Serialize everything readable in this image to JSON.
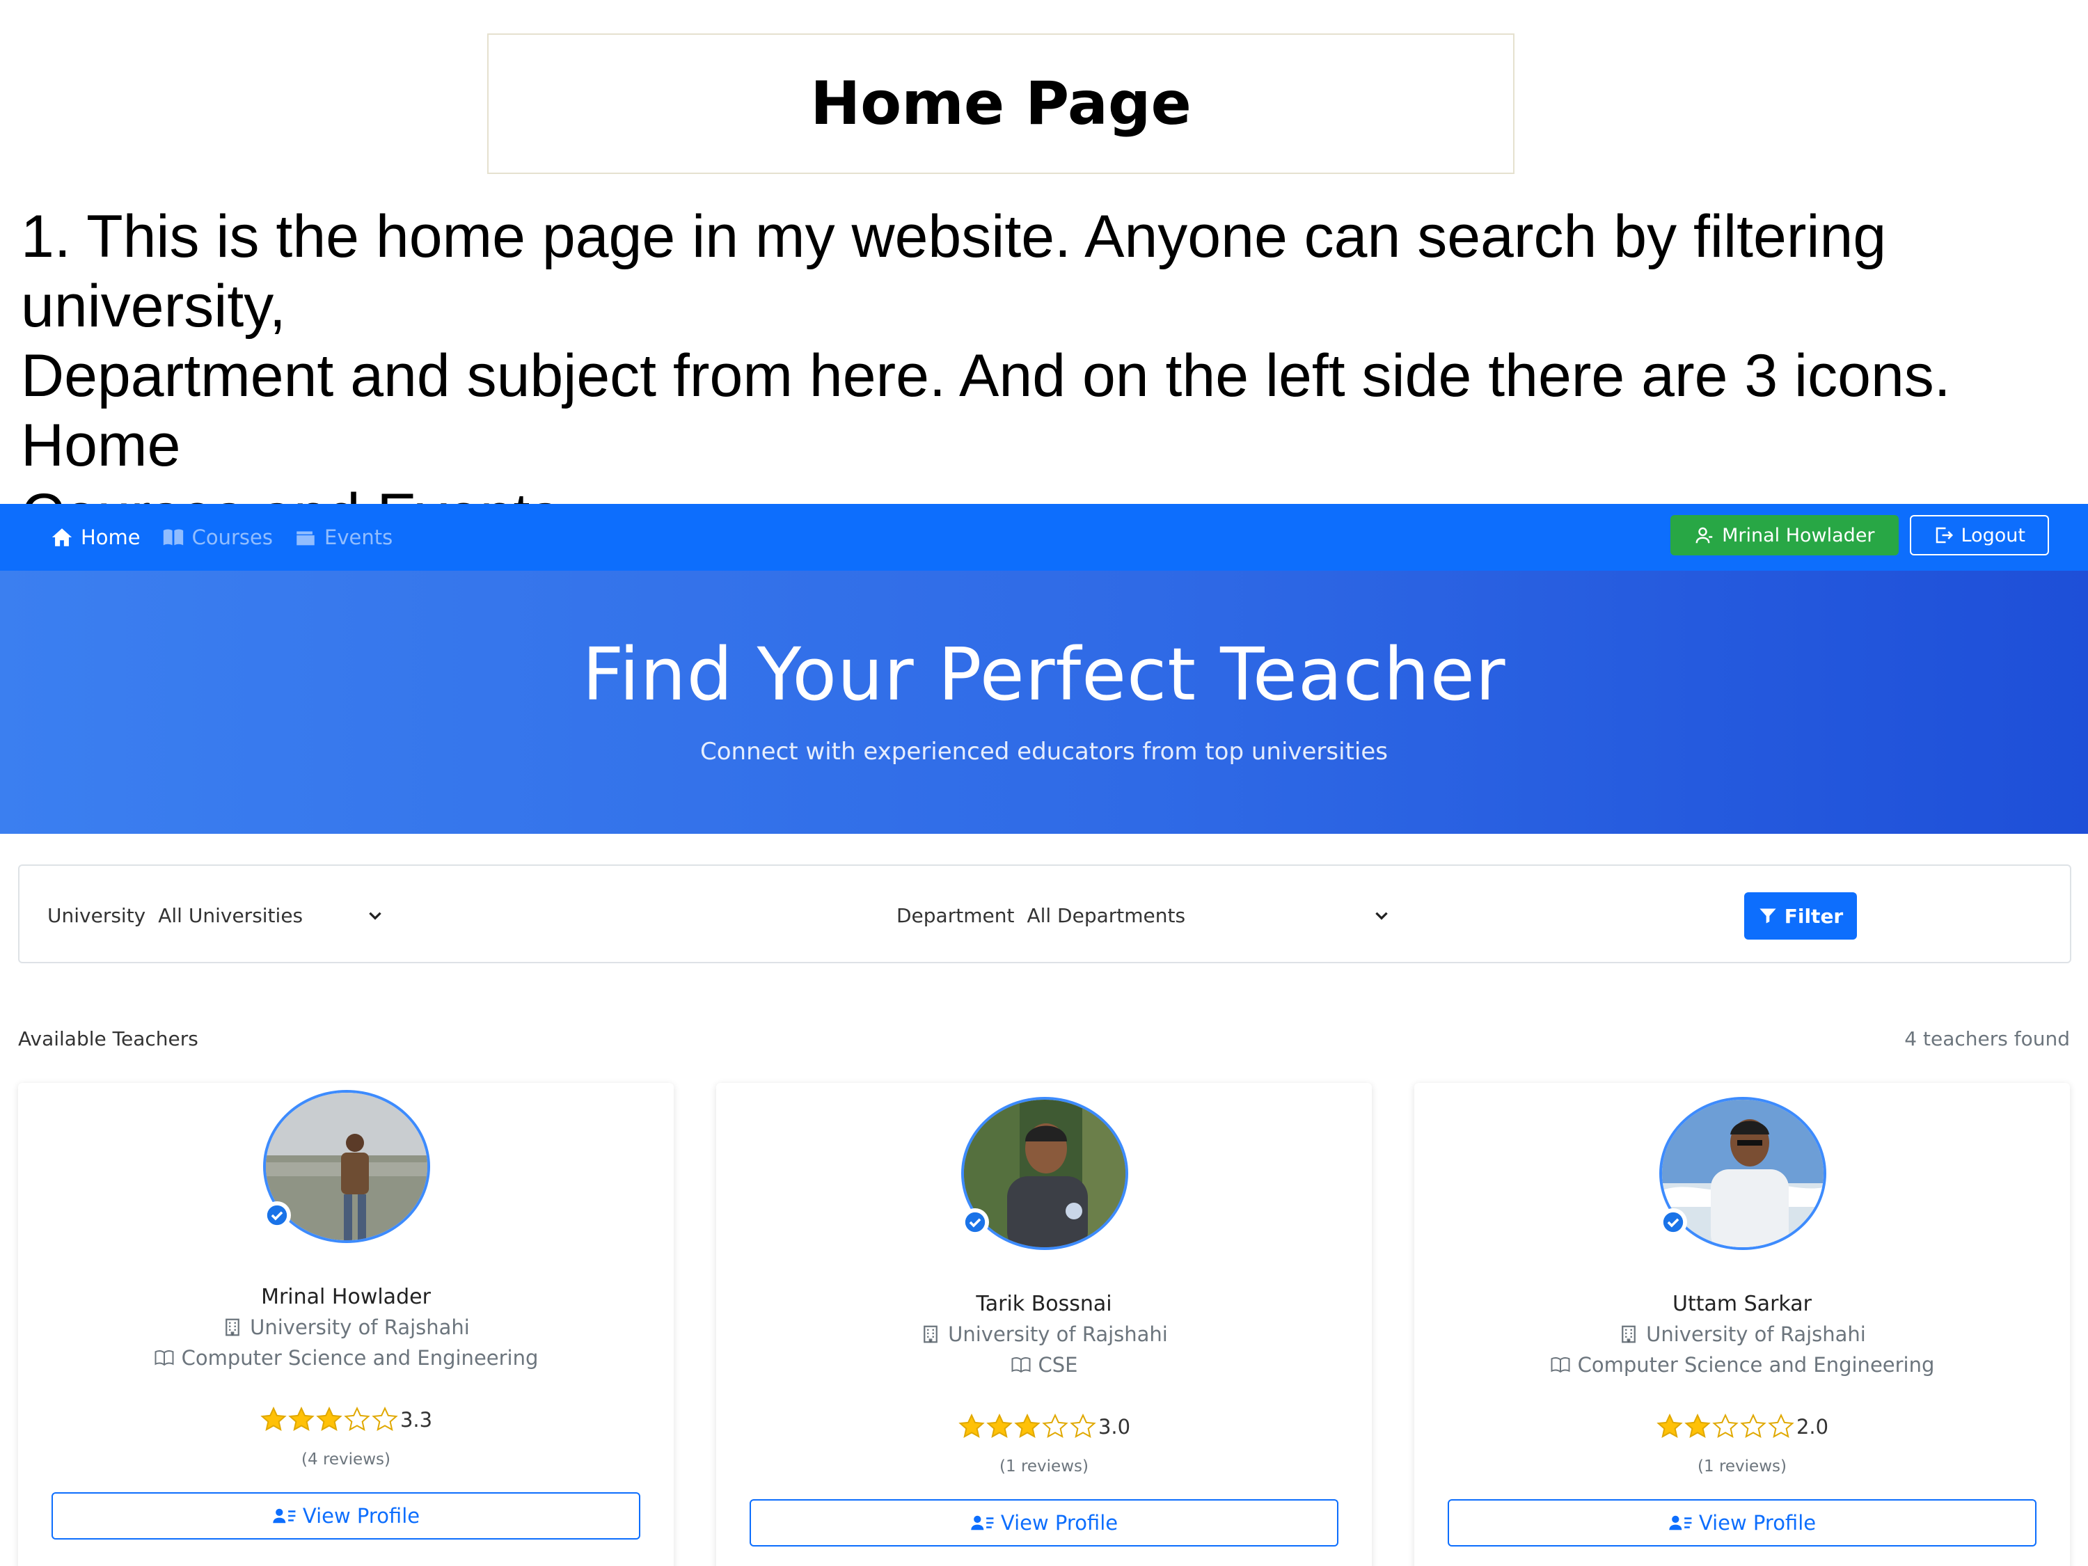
{
  "slide": {
    "title": "Home Page",
    "description_lines": [
      "1. This is the home page in my website. Anyone can search by filtering",
      "university,",
      "Department and subject from here. And on the left side there are 3 icons. Home",
      "Courses and Events."
    ]
  },
  "navbar": {
    "items": [
      {
        "label": "Home",
        "icon": "home-icon"
      },
      {
        "label": "Courses",
        "icon": "book-icon"
      },
      {
        "label": "Events",
        "icon": "wallet-icon"
      }
    ],
    "user_label": "Mrinal Howlader",
    "logout_label": "Logout",
    "colors": {
      "bar": "#0d6efd",
      "user_button": "#28a745"
    }
  },
  "hero": {
    "title": "Find Your Perfect Teacher",
    "subtitle": "Connect with experienced educators from top universities"
  },
  "filters": {
    "university_label": "University",
    "university_value": "All Universities",
    "department_label": "Department",
    "department_value": "All Departments",
    "filter_button": "Filter"
  },
  "teachers_section": {
    "title": "Available Teachers",
    "count": "4 teachers found"
  },
  "teachers": [
    {
      "name": "Mrinal Howlader",
      "university": "University of Rajshahi",
      "department": "Computer Science and Engineering",
      "rating": "3.3",
      "stars": 3.3,
      "reviews": "(4 reviews)",
      "button": "View Profile"
    },
    {
      "name": "Tarik Bossnai",
      "university": "University of Rajshahi",
      "department": "CSE",
      "rating": "3.0",
      "stars": 3.0,
      "reviews": "(1 reviews)",
      "button": "View Profile"
    },
    {
      "name": "Uttam Sarkar",
      "university": "University of Rajshahi",
      "department": "Computer Science and Engineering",
      "rating": "2.0",
      "stars": 2.0,
      "reviews": "(1 reviews)",
      "button": "View Profile"
    }
  ]
}
